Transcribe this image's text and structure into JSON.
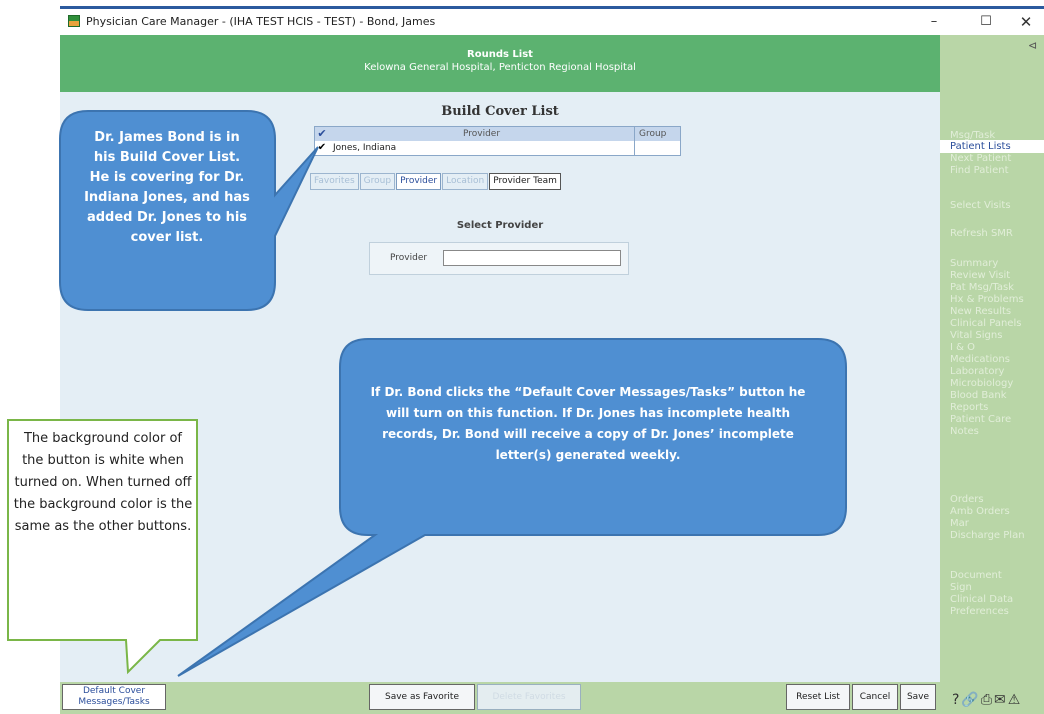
{
  "window": {
    "title": "Physician Care Manager - (IHA TEST HCIS - TEST) - Bond, James",
    "controls": [
      "–",
      "☐",
      "✕"
    ]
  },
  "header": {
    "title": "Rounds List",
    "subtitle": "Kelowna General Hospital, Penticton Regional Hospital"
  },
  "build_cover": {
    "title": "Build Cover List",
    "columns": [
      "✔",
      "Provider",
      "Group"
    ],
    "rows": [
      {
        "checked": "✔",
        "provider": "Jones, Indiana",
        "group": ""
      }
    ],
    "tabs": [
      {
        "label": "Favorites",
        "state": "disabled"
      },
      {
        "label": "Group",
        "state": "disabled"
      },
      {
        "label": "Provider",
        "state": "active"
      },
      {
        "label": "Location",
        "state": "disabled"
      },
      {
        "label": "Provider Team",
        "state": "normal"
      }
    ]
  },
  "select_provider": {
    "heading": "Select Provider",
    "label": "Provider",
    "value": ""
  },
  "sidebar": {
    "collapse_icon": "⊲",
    "items": [
      {
        "label": "Msg/Task",
        "active": false
      },
      {
        "label": "Patient Lists",
        "active": true
      },
      {
        "label": "Next Patient",
        "active": false
      },
      {
        "label": "Find Patient",
        "active": false
      },
      {
        "label": "Select Visits",
        "active": false
      },
      {
        "label": "Refresh SMR",
        "active": false
      },
      {
        "label": "Summary",
        "active": false
      },
      {
        "label": "Review Visit",
        "active": false
      },
      {
        "label": "Pat Msg/Task",
        "active": false
      },
      {
        "label": "Hx & Problems",
        "active": false
      },
      {
        "label": "New Results",
        "active": false
      },
      {
        "label": "Clinical Panels",
        "active": false
      },
      {
        "label": "Vital Signs",
        "active": false
      },
      {
        "label": "I & O",
        "active": false
      },
      {
        "label": "Medications",
        "active": false
      },
      {
        "label": "Laboratory",
        "active": false
      },
      {
        "label": "Microbiology",
        "active": false
      },
      {
        "label": "Blood Bank",
        "active": false
      },
      {
        "label": "Reports",
        "active": false
      },
      {
        "label": "Patient Care",
        "active": false
      },
      {
        "label": "Notes",
        "active": false
      },
      {
        "label": "Orders",
        "active": false
      },
      {
        "label": "Amb Orders",
        "active": false
      },
      {
        "label": "Mar",
        "active": false
      },
      {
        "label": "Discharge Plan",
        "active": false
      },
      {
        "label": "Document",
        "active": false
      },
      {
        "label": "Sign",
        "active": false
      },
      {
        "label": "Clinical Data",
        "active": false
      },
      {
        "label": "Preferences",
        "active": false
      }
    ],
    "bottom_icons": "?🔗⎙✉⚠"
  },
  "bottom_bar": {
    "default_cover_line1": "Default Cover",
    "default_cover_line2": "Messages/Tasks",
    "save_as_favorite": "Save as Favorite",
    "delete_favorites": "Delete Favorites",
    "reset_list": "Reset List",
    "cancel": "Cancel",
    "save": "Save"
  },
  "callouts": {
    "provider_note": "Dr. James Bond is in his Build Cover List. He is covering for Dr. Indiana Jones, and has added Dr. Jones to his cover list.",
    "default_cover_note": "If Dr. Bond clicks the “Default Cover Messages/Tasks” button he will turn on this function. If Dr. Jones has incomplete health records, Dr. Bond will receive a copy of Dr. Jones’ incomplete letter(s) generated weekly.",
    "button_color_note": "The background color of the button is white when turned on. When turned off the background color is the same as the other buttons."
  },
  "colors": {
    "header_green": "#5cb270",
    "sidebar_green": "#b9d6a7",
    "content_bg": "#e4eef5",
    "callout_blue": "#4f8fd2",
    "note_border_green": "#7ab648"
  }
}
